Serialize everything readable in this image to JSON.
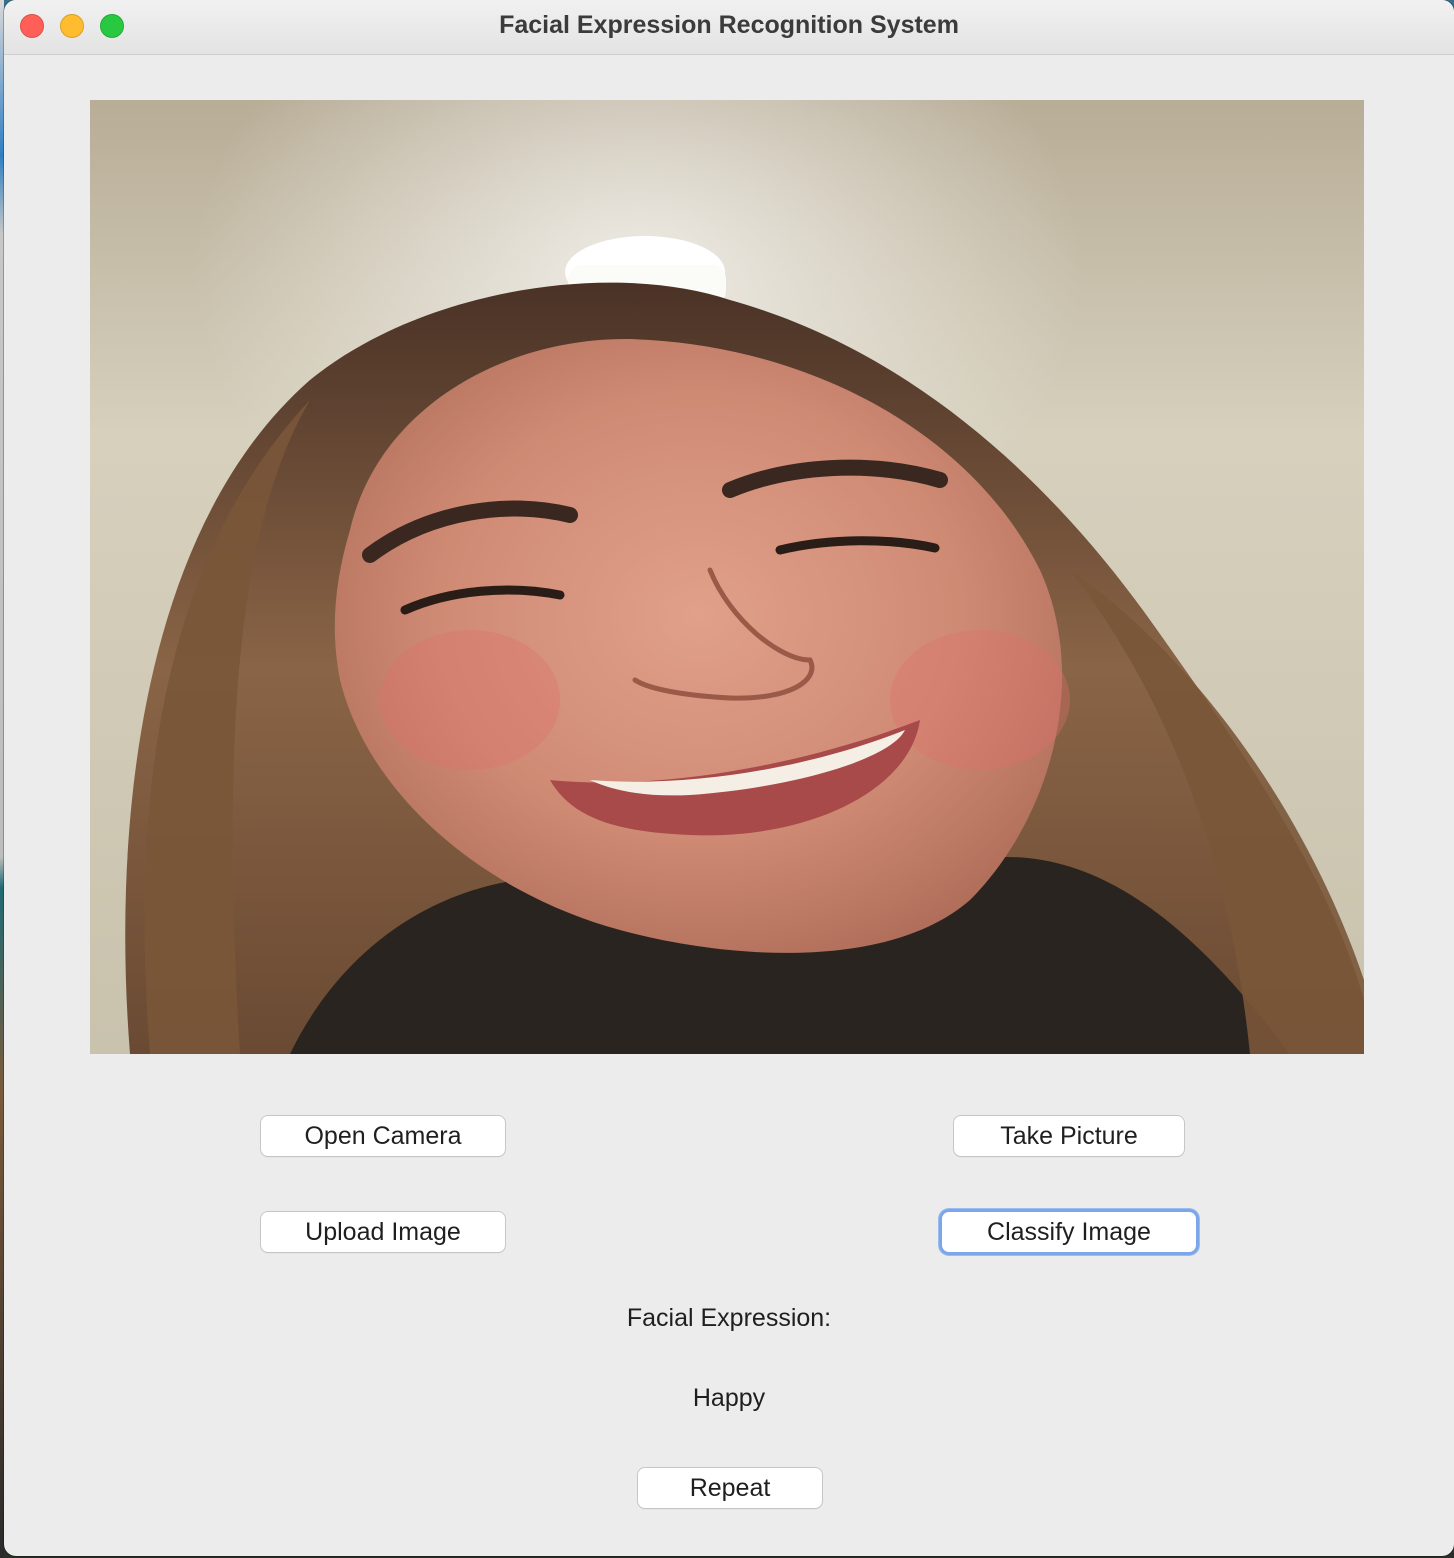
{
  "window": {
    "title": "Facial Expression Recognition System"
  },
  "photo": {
    "icon": "camera-frame-photo"
  },
  "buttons": {
    "open_camera": "Open Camera",
    "take_picture": "Take Picture",
    "upload_image": "Upload Image",
    "classify_image": "Classify Image",
    "repeat": "Repeat"
  },
  "result": {
    "label": "Facial Expression:",
    "value": "Happy"
  },
  "colors": {
    "window_bg": "#ececec",
    "focus_ring": "#7ba7ea",
    "close": "#ff5f57",
    "minimize": "#febc2e",
    "maximize": "#28c840"
  }
}
